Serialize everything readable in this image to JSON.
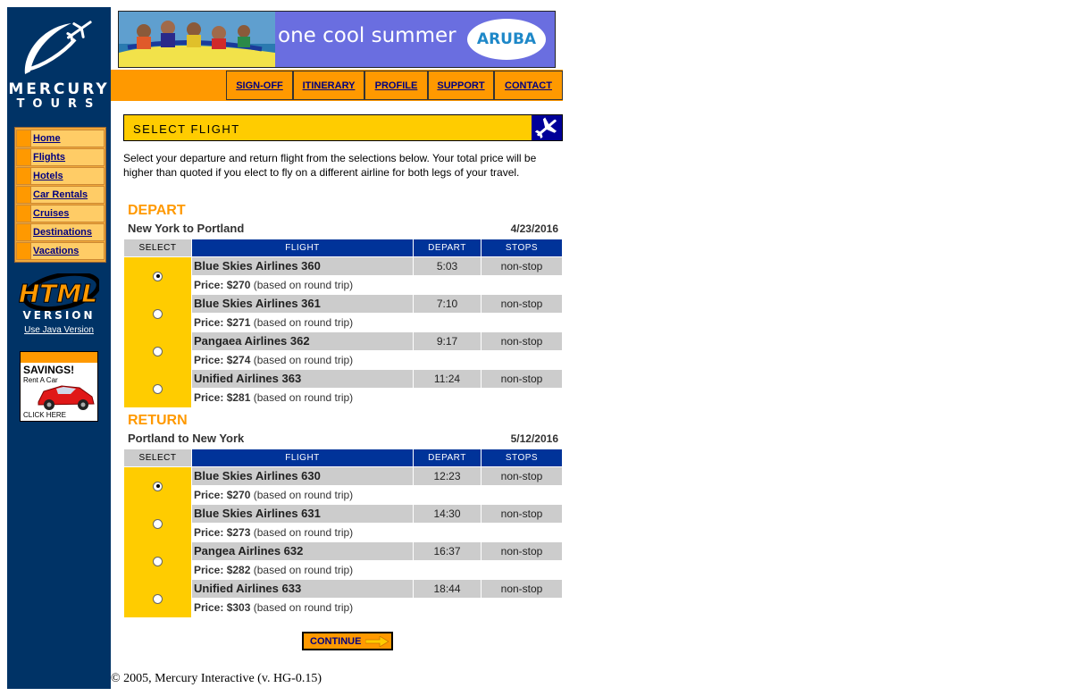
{
  "brand": {
    "line1": "MERCURY",
    "line2": "TOURS"
  },
  "sidebar": {
    "nav": [
      {
        "label": "Home"
      },
      {
        "label": "Flights"
      },
      {
        "label": "Hotels"
      },
      {
        "label": "Car Rentals"
      },
      {
        "label": "Cruises"
      },
      {
        "label": "Destinations"
      },
      {
        "label": "Vacations"
      }
    ],
    "html_badge": {
      "line1": "HTML",
      "line2": "VERSION"
    },
    "java_link": "Use Java Version",
    "ad": {
      "title": "SAVINGS!",
      "subtitle": "Rent A Car",
      "cta": "CLICK HERE"
    }
  },
  "banner": {
    "slogan": "one cool summer",
    "badge": "ARUBA"
  },
  "topnav": [
    "SIGN-OFF",
    "ITINERARY",
    "PROFILE",
    "SUPPORT",
    "CONTACT"
  ],
  "page": {
    "title": "SELECT FLIGHT",
    "intro": "Select your departure and return flight from the selections below. Your total price will be higher than quoted if you elect to fly on a different airline for both legs of your travel."
  },
  "table_headers": {
    "select": "SELECT",
    "flight": "FLIGHT",
    "depart": "DEPART",
    "stops": "STOPS"
  },
  "price_prefix": "Price:",
  "price_suffix": "(based on round trip)",
  "depart": {
    "title": "DEPART",
    "route": "New York to Portland",
    "date": "4/23/2016",
    "flights": [
      {
        "airline": "Blue Skies Airlines 360",
        "depart": "5:03",
        "stops": "non-stop",
        "price": "$270",
        "selected": true
      },
      {
        "airline": "Blue Skies Airlines 361",
        "depart": "7:10",
        "stops": "non-stop",
        "price": "$271",
        "selected": false
      },
      {
        "airline": "Pangaea Airlines 362",
        "depart": "9:17",
        "stops": "non-stop",
        "price": "$274",
        "selected": false
      },
      {
        "airline": "Unified Airlines 363",
        "depart": "11:24",
        "stops": "non-stop",
        "price": "$281",
        "selected": false
      }
    ]
  },
  "return": {
    "title": "RETURN",
    "route": "Portland to New York",
    "date": "5/12/2016",
    "flights": [
      {
        "airline": "Blue Skies Airlines 630",
        "depart": "12:23",
        "stops": "non-stop",
        "price": "$270",
        "selected": true
      },
      {
        "airline": "Blue Skies Airlines 631",
        "depart": "14:30",
        "stops": "non-stop",
        "price": "$273",
        "selected": false
      },
      {
        "airline": "Pangea Airlines 632",
        "depart": "16:37",
        "stops": "non-stop",
        "price": "$282",
        "selected": false
      },
      {
        "airline": "Unified Airlines 633",
        "depart": "18:44",
        "stops": "non-stop",
        "price": "$303",
        "selected": false
      }
    ]
  },
  "continue_label": "CONTINUE",
  "footer": "© 2005, Mercury Interactive (v. HG-0.15)",
  "colors": {
    "sidebar": "#003366",
    "accent": "#ff9900",
    "highlight": "#ffcc00",
    "header_blue": "#003399"
  }
}
